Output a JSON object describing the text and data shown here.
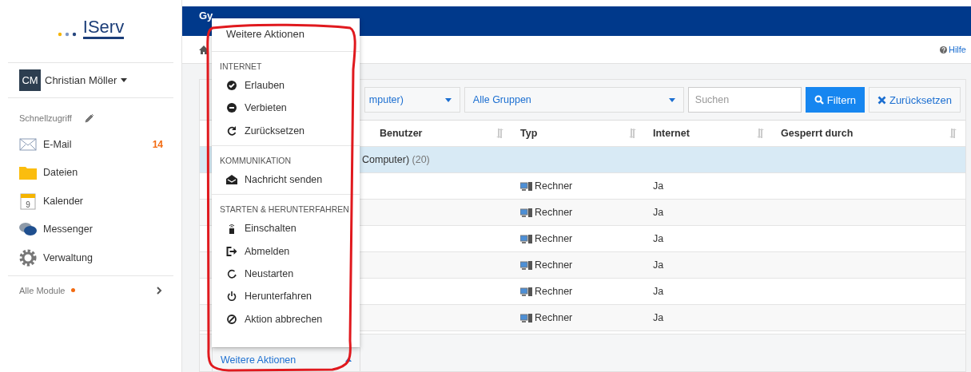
{
  "logo": {
    "text": "IServ"
  },
  "user": {
    "initials": "CM",
    "name": "Christian Möller"
  },
  "quick_access": {
    "label": "Schnellzugriff"
  },
  "nav": [
    {
      "kind": "mail",
      "label": "E-Mail",
      "badge": "14"
    },
    {
      "kind": "folder",
      "label": "Dateien"
    },
    {
      "kind": "calendar",
      "label": "Kalender",
      "day": "9"
    },
    {
      "kind": "chat",
      "label": "Messenger"
    },
    {
      "kind": "gear",
      "label": "Verwaltung"
    }
  ],
  "all_modules": {
    "label": "Alle Module"
  },
  "header": {
    "title": "Gy"
  },
  "help": {
    "label": "Hilfe"
  },
  "filters": {
    "room": "mputer)",
    "group": "Alle Gruppen",
    "search_placeholder": "Suchen",
    "filter_button": "Filtern",
    "reset_button": "Zurücksetzen"
  },
  "table": {
    "columns": [
      "Benutzer",
      "Typ",
      "Internet",
      "Gesperrt durch"
    ],
    "group": {
      "label": "Computer)",
      "count": "(20)"
    },
    "rows": [
      {
        "type": "Rechner",
        "internet": "Ja"
      },
      {
        "type": "Rechner",
        "internet": "Ja"
      },
      {
        "type": "Rechner",
        "internet": "Ja"
      },
      {
        "type": "Rechner",
        "internet": "Ja"
      },
      {
        "type": "Rechner",
        "internet": "Ja"
      },
      {
        "type": "Rechner",
        "internet": "Ja"
      }
    ]
  },
  "footer": {
    "button": "Weitere Aktionen"
  },
  "menu": {
    "title": "Weitere Aktionen",
    "sections": [
      {
        "heading": "INTERNET",
        "items": [
          {
            "kind": "check",
            "label": "Erlauben"
          },
          {
            "kind": "minus",
            "label": "Verbieten"
          },
          {
            "kind": "refresh",
            "label": "Zurücksetzen"
          }
        ]
      },
      {
        "heading": "KOMMUNIKATION",
        "items": [
          {
            "kind": "envelope",
            "label": "Nachricht senden"
          }
        ]
      },
      {
        "heading": "STARTEN & HERUNTERFAHREN",
        "items": [
          {
            "kind": "wake",
            "label": "Einschalten"
          },
          {
            "kind": "logout",
            "label": "Abmelden"
          },
          {
            "kind": "restart",
            "label": "Neustarten"
          },
          {
            "kind": "power",
            "label": "Herunterfahren"
          },
          {
            "kind": "cancel",
            "label": "Aktion abbrechen"
          }
        ]
      }
    ]
  }
}
